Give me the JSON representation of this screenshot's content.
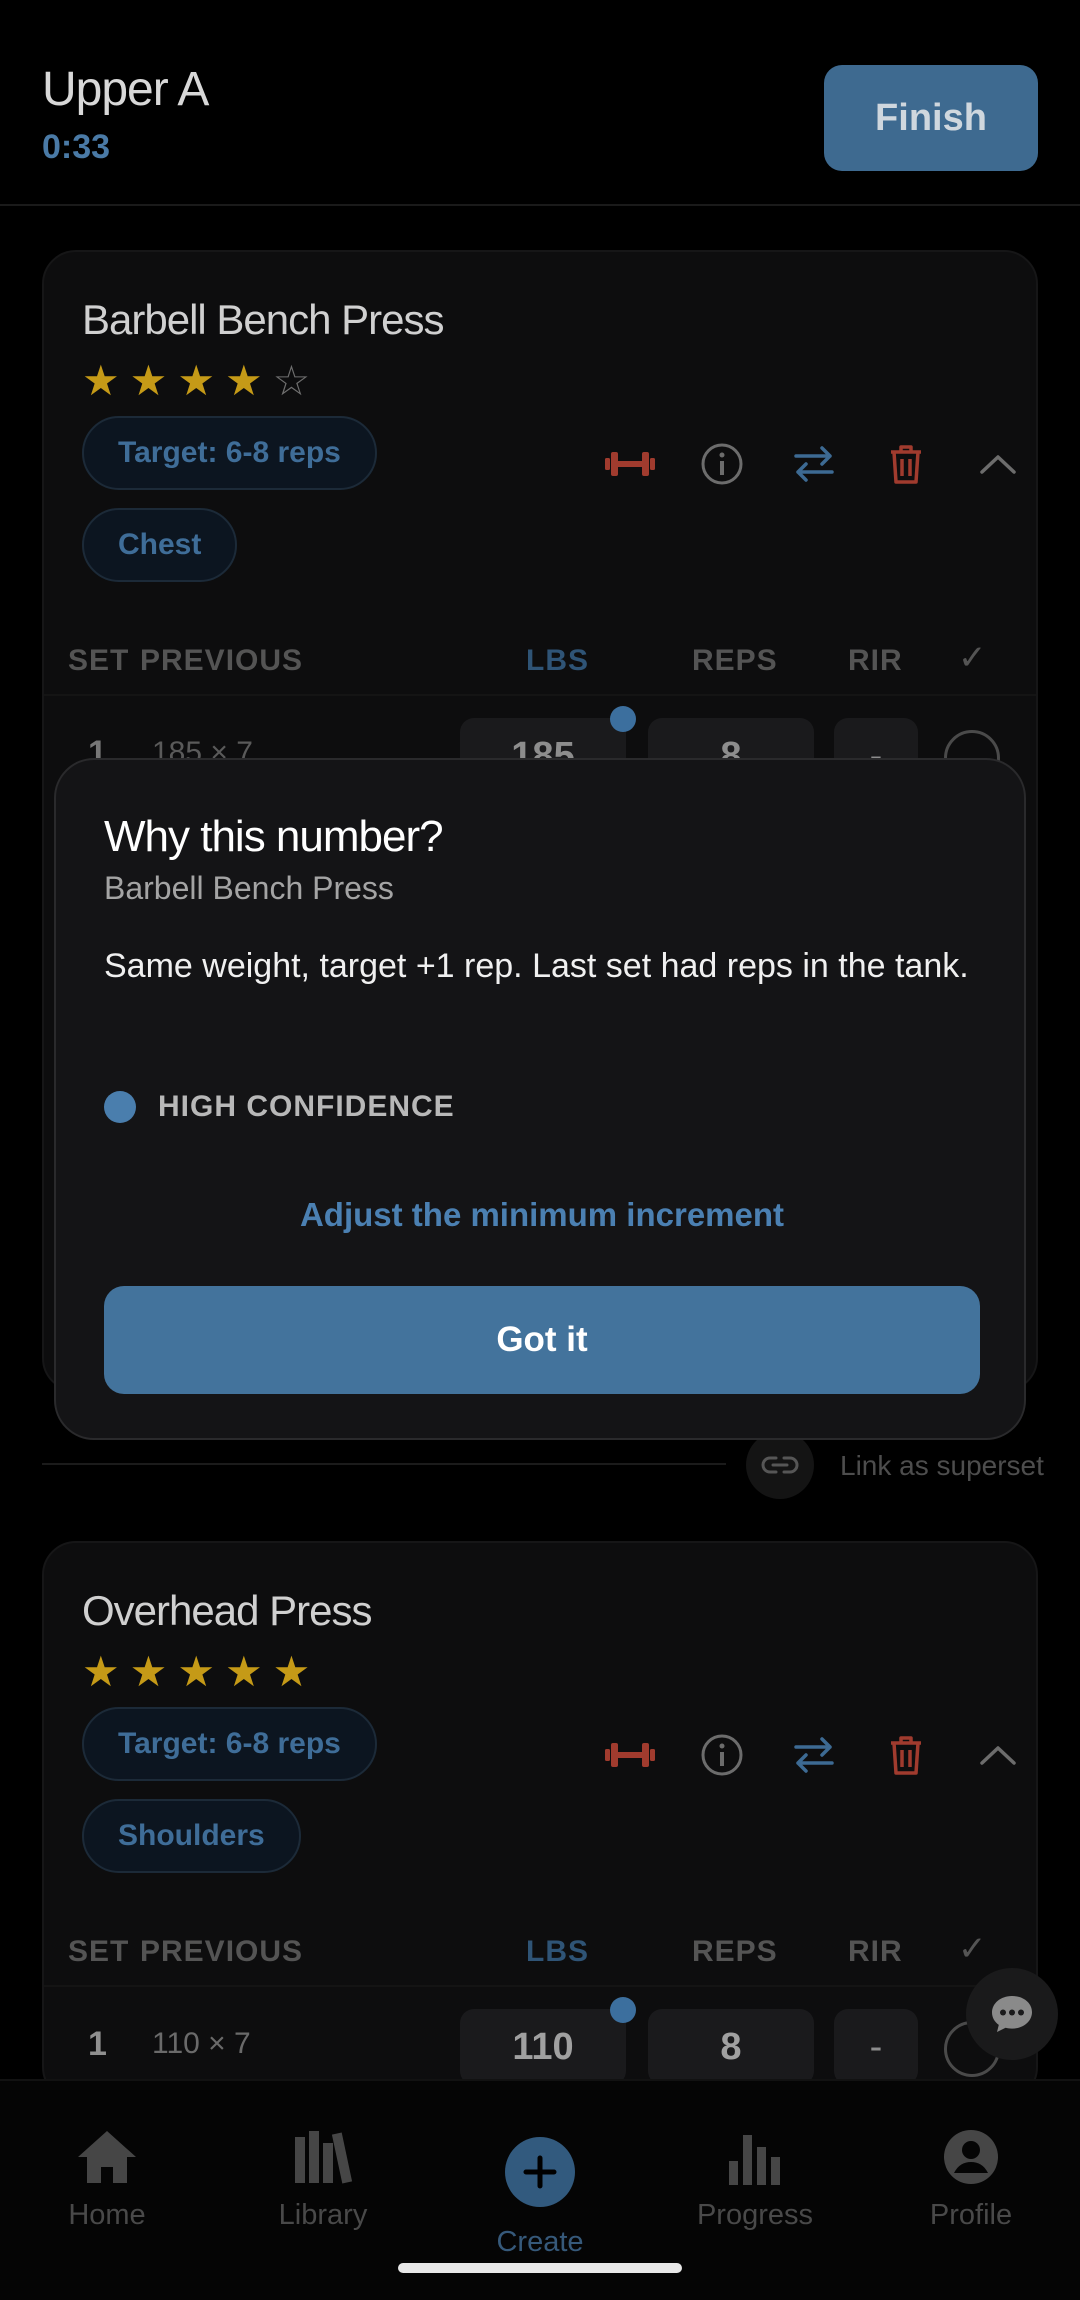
{
  "header": {
    "title": "Upper A",
    "timer": "0:33",
    "finish_label": "Finish"
  },
  "exercises": [
    {
      "name": "Barbell Bench Press",
      "rating": 4,
      "rating_max": 5,
      "chips": [
        "Target: 6-8 reps",
        "Chest"
      ],
      "columns": {
        "set": "SET",
        "previous": "PREVIOUS",
        "weight": "LBS",
        "reps": "REPS",
        "rir": "RIR",
        "done": "✓"
      },
      "sets": [
        {
          "num": "1",
          "previous": "185 × 7",
          "weight": "185",
          "reps": "8",
          "rir": "-"
        }
      ]
    },
    {
      "name": "Overhead Press",
      "rating": 5,
      "rating_max": 5,
      "chips": [
        "Target: 6-8 reps",
        "Shoulders"
      ],
      "columns": {
        "set": "SET",
        "previous": "PREVIOUS",
        "weight": "LBS",
        "reps": "REPS",
        "rir": "RIR",
        "done": "✓"
      },
      "sets": [
        {
          "num": "1",
          "previous": "110 × 7",
          "weight": "110",
          "reps": "8",
          "rir": "-"
        }
      ]
    }
  ],
  "superset": {
    "label": "Link as superset",
    "icon": "link-icon"
  },
  "card_actions": [
    "equipment-icon",
    "info-icon",
    "swap-icon",
    "trash-icon",
    "chevron-up-icon"
  ],
  "modal": {
    "title": "Why this number?",
    "subtitle": "Barbell Bench Press",
    "body": "Same weight, target +1 rep. Last set had reps in the tank.",
    "confidence": "HIGH CONFIDENCE",
    "adjust_link": "Adjust the minimum increment",
    "confirm_label": "Got it"
  },
  "nav": {
    "items": [
      {
        "label": "Home",
        "icon": "home-icon"
      },
      {
        "label": "Library",
        "icon": "library-icon"
      },
      {
        "label": "Create",
        "icon": "plus-icon"
      },
      {
        "label": "Progress",
        "icon": "bar-chart-icon"
      },
      {
        "label": "Profile",
        "icon": "profile-icon"
      }
    ]
  },
  "colors": {
    "accent": "#43739c",
    "star": "#c59a17",
    "danger": "#a03b2e",
    "background": "#000000"
  }
}
